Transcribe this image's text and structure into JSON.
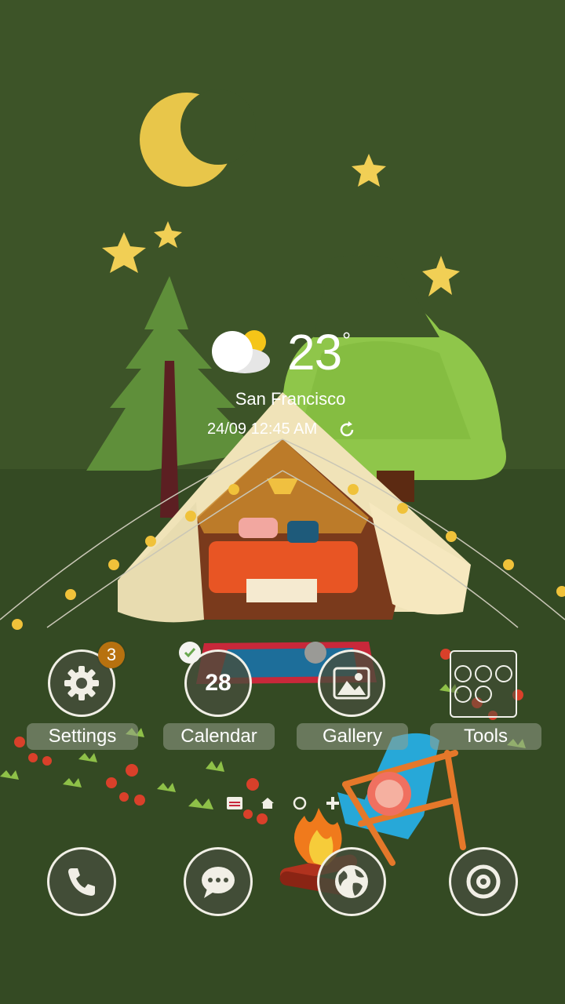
{
  "weather": {
    "temperature": "23",
    "degree_symbol": "°",
    "city": "San Francisco",
    "datetime": "24/09 12:45 AM",
    "condition_icon": "partly-cloudy-icon"
  },
  "apps": [
    {
      "label": "Settings",
      "icon": "gear-icon",
      "badge": "3"
    },
    {
      "label": "Calendar",
      "icon": "calendar-icon",
      "day": "28"
    },
    {
      "label": "Gallery",
      "icon": "image-icon"
    },
    {
      "label": "Tools",
      "icon": "folder-icon"
    }
  ],
  "pager": {
    "pages": [
      "menu-page-icon",
      "home-page-icon",
      "current-page-icon",
      "add-page-icon"
    ],
    "current_index": 2
  },
  "dock": [
    {
      "icon": "phone-icon"
    },
    {
      "icon": "messages-icon"
    },
    {
      "icon": "browser-icon"
    },
    {
      "icon": "camera-icon"
    }
  ],
  "colors": {
    "sky": "#3c5227",
    "ground": "#344a23",
    "badge": "#b7710f",
    "icon_ring": "#f1efe6"
  }
}
